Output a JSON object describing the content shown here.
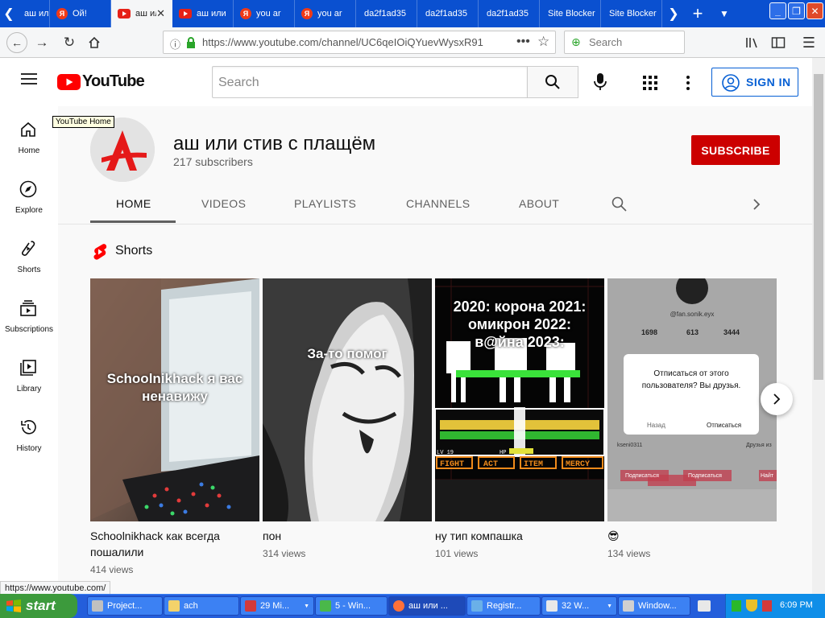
{
  "browser": {
    "tabs": [
      {
        "label": "аш или",
        "favicon": "back-arrow"
      },
      {
        "label": "Ой!",
        "favicon": "yandex"
      },
      {
        "label": "аш или",
        "favicon": "youtube",
        "active": true
      },
      {
        "label": "аш или",
        "favicon": "youtube"
      },
      {
        "label": "you ar",
        "favicon": "yandex"
      },
      {
        "label": "you ar",
        "favicon": "yandex"
      },
      {
        "label": "da2f1ad35",
        "favicon": "none"
      },
      {
        "label": "da2f1ad35",
        "favicon": "none"
      },
      {
        "label": "da2f1ad35",
        "favicon": "none"
      },
      {
        "label": "Site Blocker",
        "favicon": "none"
      },
      {
        "label": "Site Blocker",
        "favicon": "none"
      }
    ],
    "url": "https://www.youtube.com/channel/UC6qeIOiQYuevWysxR91",
    "search_placeholder": "Search",
    "status_url": "https://www.youtube.com/"
  },
  "youtube": {
    "logo_text": "YouTube",
    "search_placeholder": "Search",
    "signin_label": "SIGN IN",
    "tooltip": "YouTube Home",
    "sidebar": [
      {
        "label": "Home",
        "icon": "home-icon"
      },
      {
        "label": "Explore",
        "icon": "compass-icon"
      },
      {
        "label": "Shorts",
        "icon": "shorts-icon"
      },
      {
        "label": "Subscriptions",
        "icon": "subscriptions-icon"
      },
      {
        "label": "Library",
        "icon": "library-icon"
      },
      {
        "label": "History",
        "icon": "history-icon"
      }
    ],
    "channel": {
      "name": "аш или стив с плащём",
      "subscribers": "217 subscribers",
      "subscribe_label": "SUBSCRIBE",
      "avatar_letter": "А",
      "tabs": [
        "HOME",
        "VIDEOS",
        "PLAYLISTS",
        "CHANNELS",
        "ABOUT"
      ]
    },
    "shorts_section": {
      "label": "Shorts",
      "items": [
        {
          "overlay": "Schoolnikhack я вас ненавижу",
          "title": "Schoolnikhack как всегда пошалили",
          "views": "414 views"
        },
        {
          "overlay": "За-то помог",
          "title": "пон",
          "views": "314 views"
        },
        {
          "overlay": "2020: корона 2021: омикрон 2022: в@йна 2023:",
          "title": "ну тип компашка",
          "views": "101 views"
        },
        {
          "overlay": "Отписаться от этого пользователя? Вы друзья.",
          "title": "😎",
          "views": "134 views",
          "dialog": {
            "account": "@fan.sonik.eyx",
            "stats": [
              "1698",
              "613",
              "3444"
            ],
            "cancel": "Назад",
            "confirm": "Отписаться",
            "names": [
              "kseni0311",
              "Друзья из"
            ],
            "button": "Подписаться",
            "button_partial": "Найт"
          }
        }
      ],
      "game_ui": {
        "level": "LV 19",
        "hp": "HP",
        "buttons": [
          "FIGHT",
          "ACT",
          "ITEM",
          "MERCY"
        ]
      }
    }
  },
  "taskbar": {
    "start_label": "start",
    "tasks": [
      {
        "label": "Project..."
      },
      {
        "label": "ach"
      },
      {
        "label": "29 Mi..."
      },
      {
        "label": "5 - Win..."
      },
      {
        "label": "аш или ...",
        "active": true
      },
      {
        "label": "Registr..."
      },
      {
        "label": "32 W..."
      },
      {
        "label": "Window..."
      }
    ],
    "clock": "6:09 PM"
  }
}
